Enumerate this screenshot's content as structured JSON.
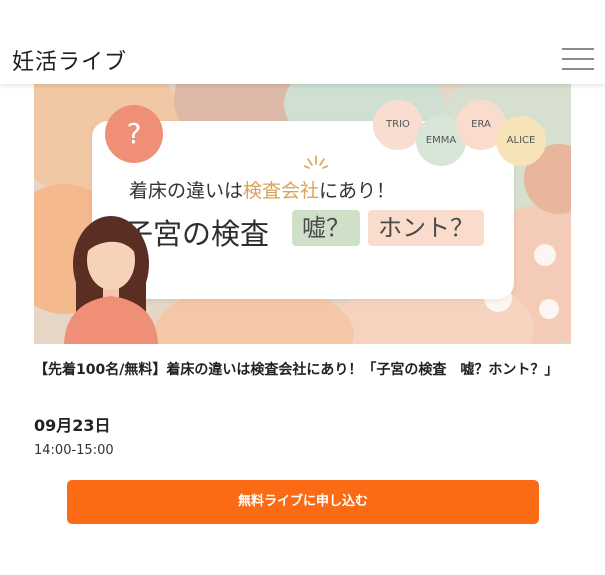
{
  "header": {
    "logo_text": "妊活ライブ",
    "menu_icon": "hamburger-menu-icon"
  },
  "banner": {
    "question_mark": "?",
    "clinics": [
      "TRIO",
      "EMMA",
      "ERA",
      "ALICE"
    ],
    "subtitle_pre": "着床の違いは",
    "subtitle_highlight": "検査会社",
    "subtitle_post": "にあり！",
    "title_main": "子宮の検査",
    "title_uso": "嘘？",
    "title_honto": "ホント？"
  },
  "event": {
    "title": "【先着100名/無料】着床の違いは検査会社にあり！「子宮の検査　嘘？ホント？」",
    "date": "09月23日",
    "time": "14:00-15:00"
  },
  "cta": {
    "label": "無料ライブに申し込む"
  },
  "colors": {
    "accent": "#fb6a14",
    "highlight": "#d9a457"
  }
}
